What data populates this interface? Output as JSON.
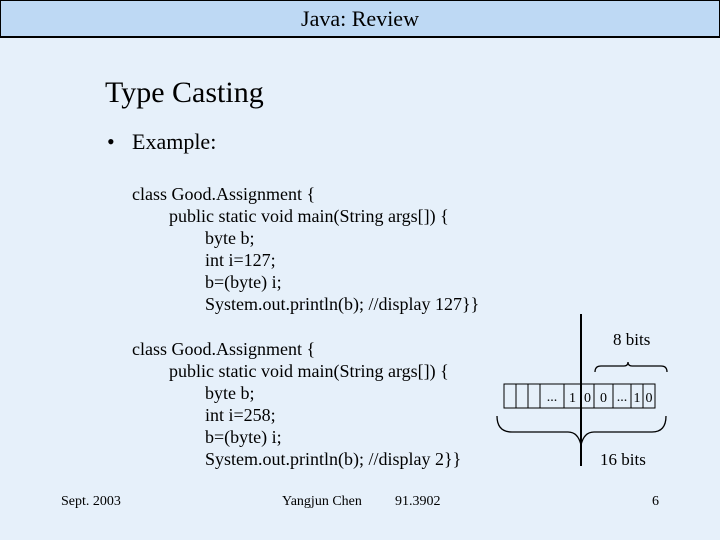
{
  "header": {
    "title": "Java: Review"
  },
  "slide": {
    "title": "Type Casting",
    "bullet": "Example:",
    "bullet_icon": "bullet-dot"
  },
  "code_example_1": {
    "lines": [
      "class Good.Assignment {",
      "public static void main(String args[]) {",
      "byte b;",
      "int i=127;",
      "b=(byte) i;",
      "System.out.println(b); //display 127}}"
    ]
  },
  "code_example_2": {
    "lines": [
      "class Good.Assignment {",
      "public static void main(String args[]) {",
      "byte b;",
      "int i=258;",
      "b=(byte) i;",
      "System.out.println(b); //display 2}}"
    ]
  },
  "diagram": {
    "label_8bits": "8 bits",
    "label_16bits": "16 bits",
    "high_byte_cells": [
      "",
      "",
      "",
      "...",
      "1"
    ],
    "low_byte_cells": [
      "0",
      "0",
      "...",
      "1",
      "0"
    ]
  },
  "footer": {
    "date": "Sept. 2003",
    "author": "Yangjun Chen",
    "course": "91.3902",
    "page": "6"
  }
}
